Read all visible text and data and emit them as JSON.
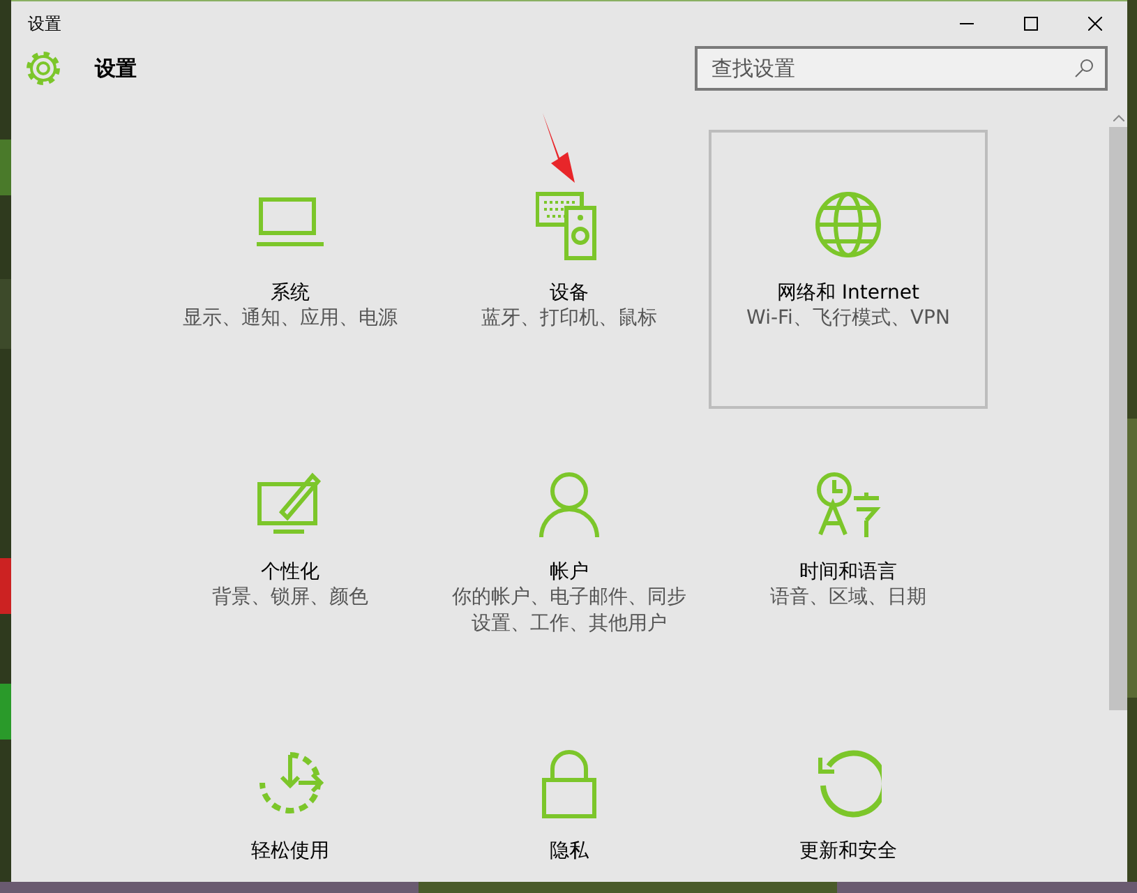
{
  "window": {
    "title": "设置"
  },
  "header": {
    "title": "设置"
  },
  "search": {
    "placeholder": "查找设置"
  },
  "tiles": [
    {
      "title": "系统",
      "subtitle": "显示、通知、应用、电源",
      "selected": false
    },
    {
      "title": "设备",
      "subtitle": "蓝牙、打印机、鼠标",
      "selected": false
    },
    {
      "title": "网络和 Internet",
      "subtitle": "Wi-Fi、飞行模式、VPN",
      "selected": true
    },
    {
      "title": "个性化",
      "subtitle": "背景、锁屏、颜色",
      "selected": false
    },
    {
      "title": "帐户",
      "subtitle": "你的帐户、电子邮件、同步设置、工作、其他用户",
      "selected": false
    },
    {
      "title": "时间和语言",
      "subtitle": "语音、区域、日期",
      "selected": false
    },
    {
      "title": "轻松使用",
      "selected": false
    },
    {
      "title": "隐私",
      "selected": false
    },
    {
      "title": "更新和安全",
      "selected": false
    }
  ]
}
